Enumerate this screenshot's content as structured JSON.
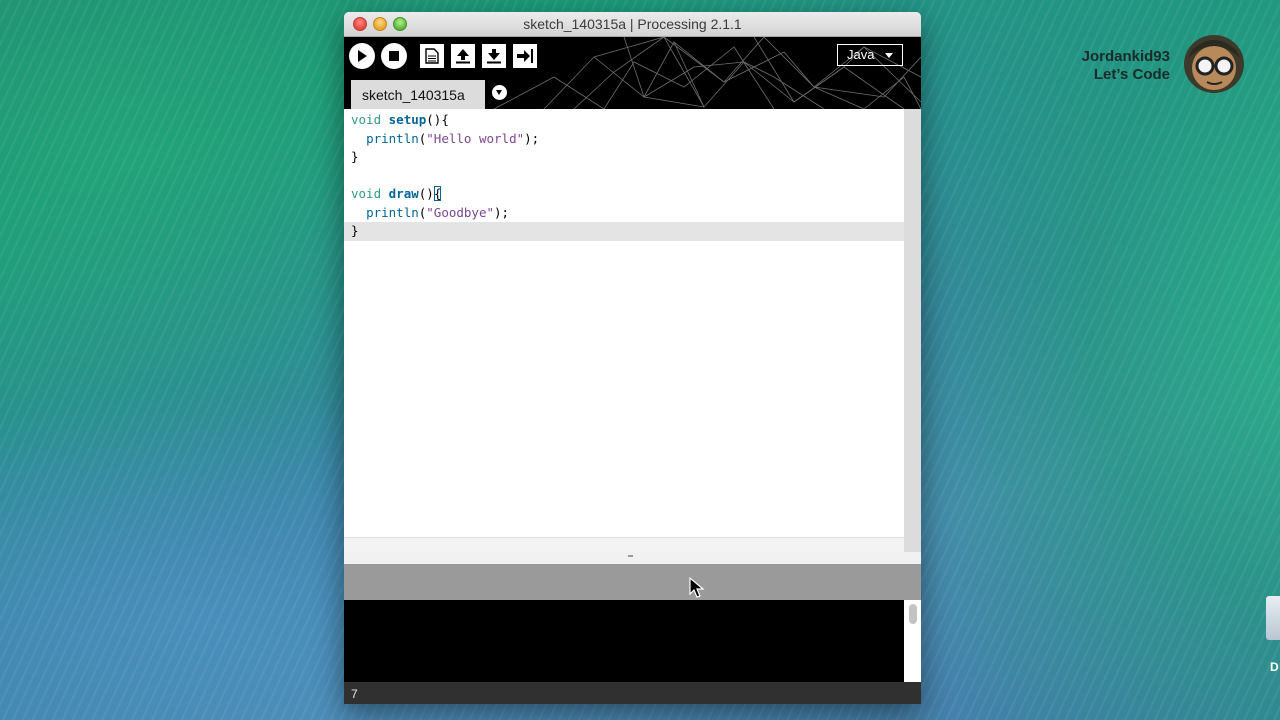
{
  "window": {
    "title": "sketch_140315a | Processing 2.1.1"
  },
  "toolbar": {
    "run_icon": "play-icon",
    "stop_icon": "stop-icon",
    "new_icon": "new-file-icon",
    "open_icon": "open-upload-icon",
    "save_icon": "save-download-icon",
    "export_icon": "export-icon",
    "mode": "Java"
  },
  "tabs": {
    "active": "sketch_140315a"
  },
  "editor": {
    "lines": [
      {
        "kw": "void",
        "fn": "setup",
        "rest": "(){"
      },
      {
        "indent": "  ",
        "call": "println",
        "open": "(",
        "str": "\"Hello world\"",
        "close": ");"
      },
      {
        "text": "}"
      },
      {
        "text": ""
      },
      {
        "kw": "void",
        "fn": "draw",
        "rest": "()",
        "bracket": "{"
      },
      {
        "indent": "  ",
        "call": "println",
        "open": "(",
        "str": "\"Goodbye\"",
        "close": ");"
      },
      {
        "text": "}"
      }
    ]
  },
  "status": {
    "line_number": "7"
  },
  "watermark": {
    "line1": "Jordankid93",
    "line2": "Let’s Code"
  },
  "desktop": {
    "icon_label": "D"
  },
  "colors": {
    "keyword": "#33997e",
    "function": "#006699",
    "string": "#7d4793",
    "console_bg": "#000000",
    "message_bg": "#9a9a9a"
  }
}
